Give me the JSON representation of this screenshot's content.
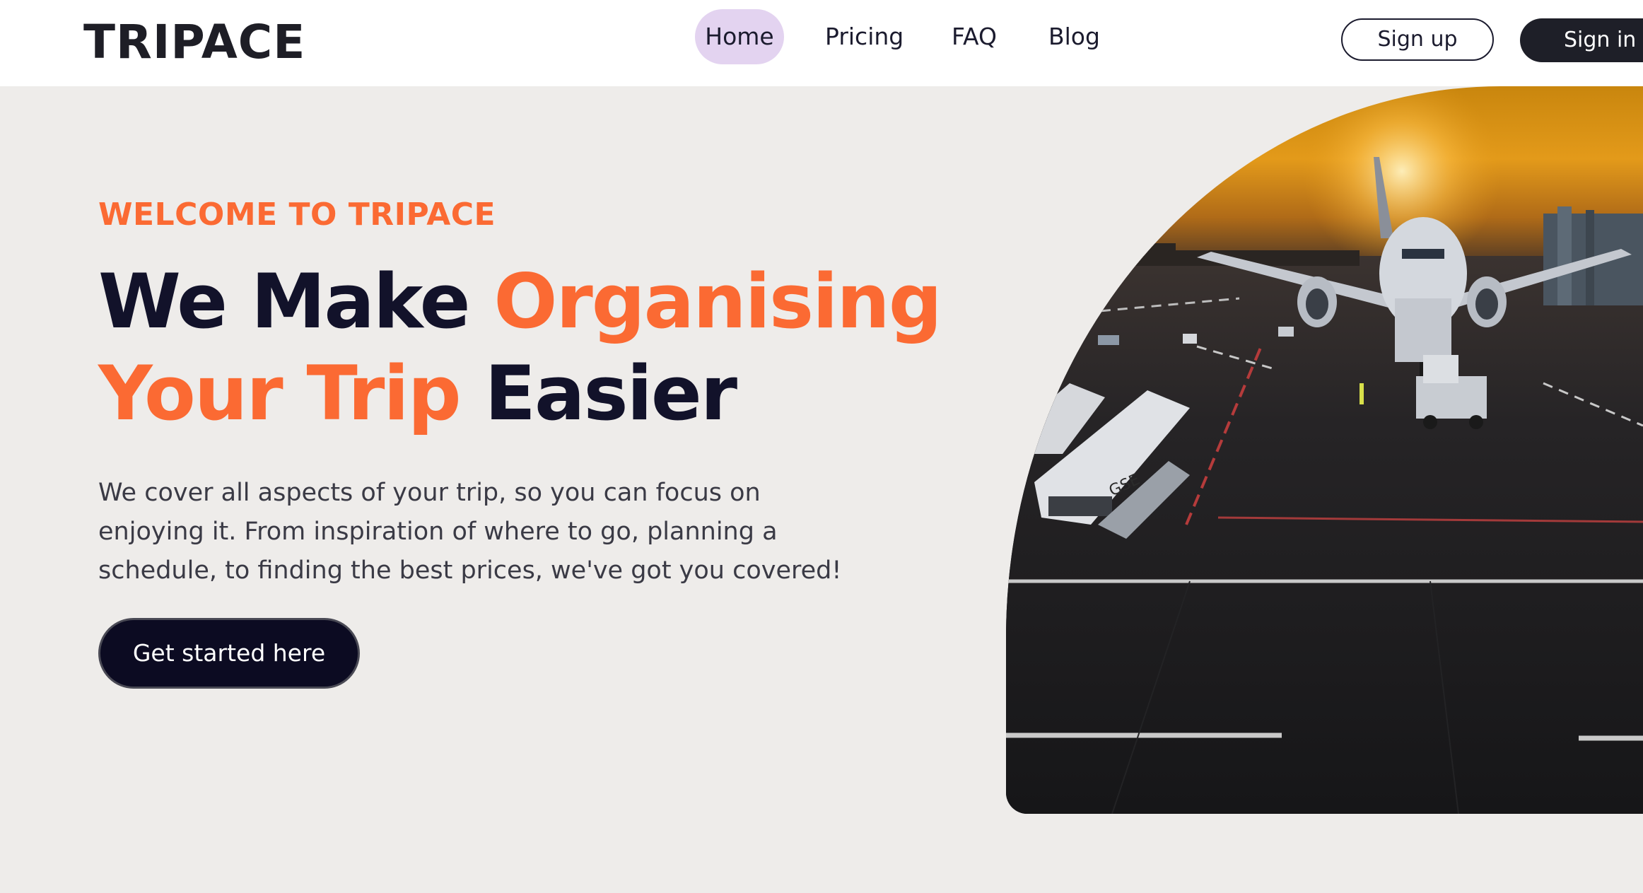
{
  "header": {
    "logo": "TRIPACE",
    "nav": [
      {
        "label": "Home",
        "active": true
      },
      {
        "label": "Pricing",
        "active": false
      },
      {
        "label": "FAQ",
        "active": false
      },
      {
        "label": "Blog",
        "active": false
      }
    ],
    "signup_label": "Sign up",
    "signin_label": "Sign in"
  },
  "hero": {
    "eyebrow": "WELCOME TO TRIPACE",
    "headline": {
      "part1": "We Make ",
      "part2": "Organising",
      "part3": "Your Trip",
      "part4": " Easier"
    },
    "description": "We cover all aspects of your trip, so you can focus on enjoying it. From inspiration of where to go, planning a schedule, to finding the best prices, we've got you covered!",
    "cta_label": "Get started here"
  },
  "colors": {
    "accent": "#fb6a33",
    "dark": "#0c0b22",
    "nav_active_bg": "#e3d3f0",
    "hero_bg": "#eeecea"
  }
}
